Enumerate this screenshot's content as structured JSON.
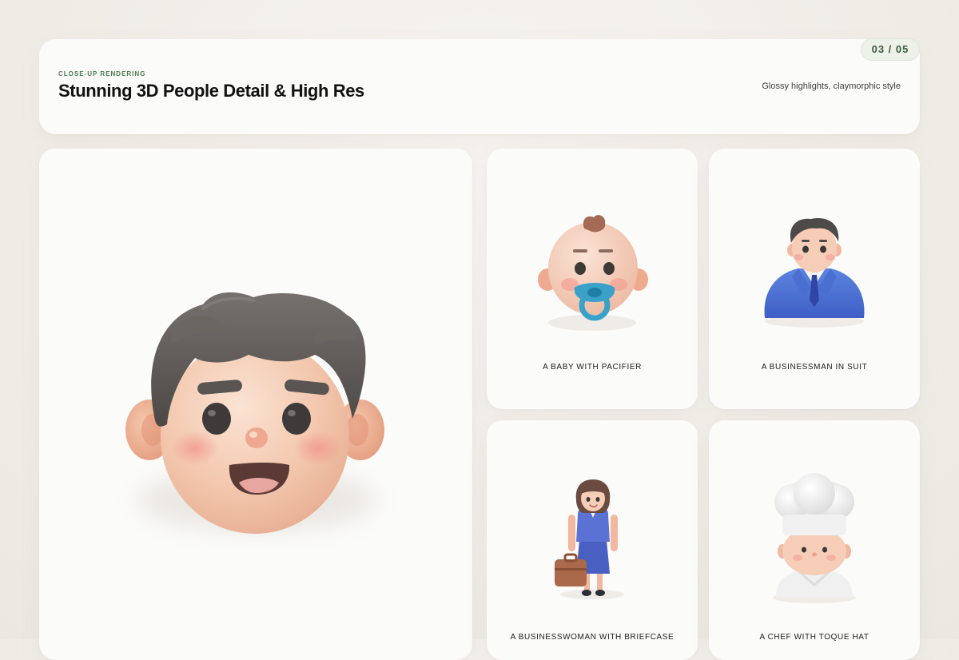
{
  "header": {
    "eyebrow": "CLOSE-UP RENDERING",
    "title": "Stunning 3D People Detail & High Res",
    "subtitle": "Glossy highlights, claymorphic style",
    "pager": "03 / 05"
  },
  "tiles": [
    {
      "caption": "A BABY WITH PACIFIER",
      "icon": "baby-with-pacifier-icon"
    },
    {
      "caption": "A BUSINESSMAN IN SUIT",
      "icon": "businessman-icon"
    },
    {
      "caption": "A BUSINESSWOMAN WITH BRIEFCASE",
      "icon": "businesswoman-icon"
    },
    {
      "caption": "A CHEF WITH TOQUE HAT",
      "icon": "chef-icon"
    }
  ],
  "hero": {
    "icon": "smiling-face-icon"
  },
  "colors": {
    "accent_green": "#4a7a4d",
    "skin": "#f3c7ad",
    "hair": "#5f5b59",
    "suit_blue": "#4a6fd1",
    "pacifier_blue": "#3aa2c9"
  }
}
